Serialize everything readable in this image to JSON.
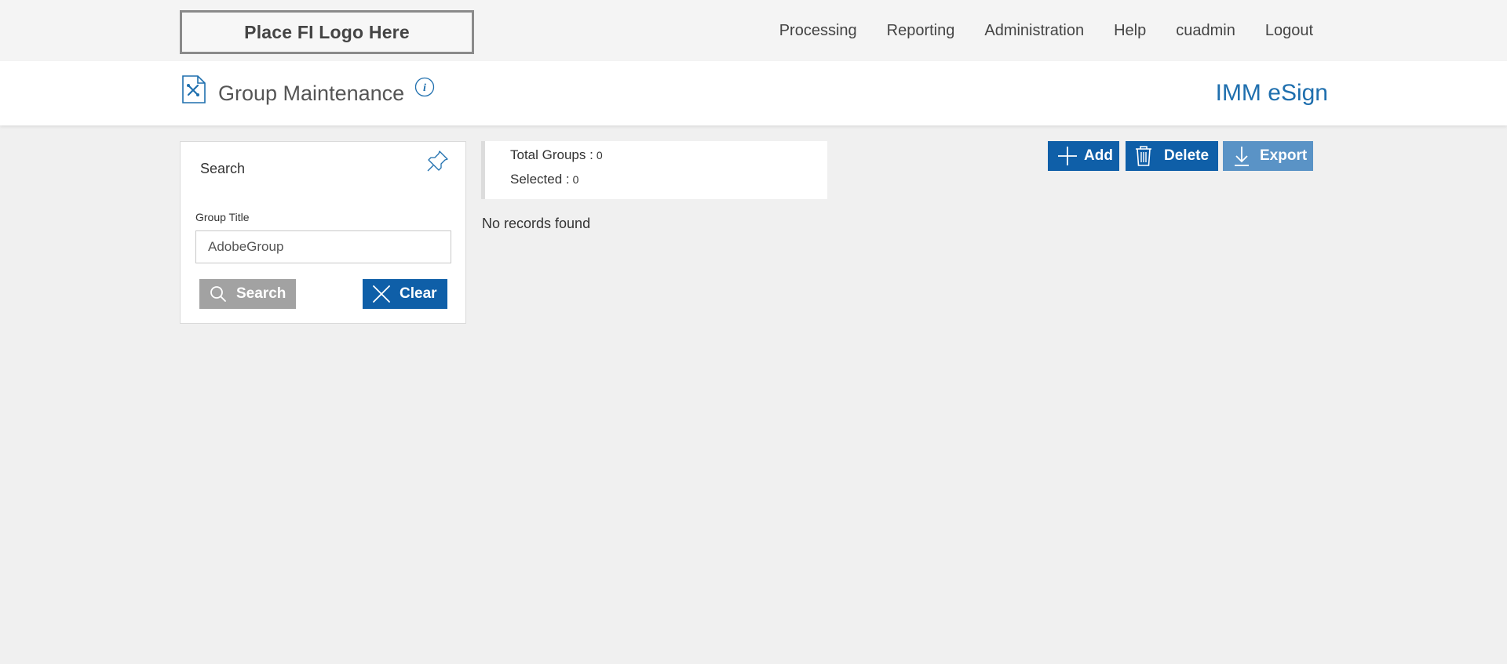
{
  "header": {
    "logo_text": "Place FI Logo Here",
    "nav": [
      {
        "label": "Processing"
      },
      {
        "label": "Reporting"
      },
      {
        "label": "Administration"
      },
      {
        "label": "Help"
      },
      {
        "label": "cuadmin"
      },
      {
        "label": "Logout"
      }
    ]
  },
  "page": {
    "title": "Group Maintenance",
    "brand": "IMM eSign",
    "icons": {
      "page": "document-tools-icon",
      "info": "info-icon"
    }
  },
  "search_panel": {
    "title": "Search",
    "pin_icon": "pin-icon",
    "field_label": "Group Title",
    "field_value": "AdobeGroup",
    "search_button": "Search",
    "clear_button": "Clear"
  },
  "summary": {
    "total_label": "Total Groups :",
    "total_value": "0",
    "selected_label": "Selected :",
    "selected_value": "0",
    "empty_message": "No records found"
  },
  "actions": {
    "add": "Add",
    "delete": "Delete",
    "export": "Export"
  },
  "colors": {
    "primary": "#0f5fa8",
    "primary_light": "#5a93c6",
    "neutral_button": "#a2a2a2",
    "brand_text": "#1f6fae",
    "background": "#f0f0f0"
  }
}
